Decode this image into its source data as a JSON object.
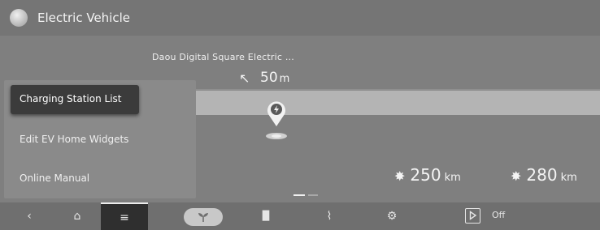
{
  "window": {
    "title": "Electric Vehicle",
    "icon": "moon-icon"
  },
  "map": {
    "destination": "Daou Digital Square Electric ...",
    "direction_icon": "arrow-up-left-icon",
    "distance_value": "50",
    "distance_unit": "m",
    "marker_icon": "charging-station-pin-icon"
  },
  "ranges": [
    {
      "icon": "fan-icon",
      "value": "250",
      "unit": "km"
    },
    {
      "icon": "fan-off-icon",
      "value": "280",
      "unit": "km"
    }
  ],
  "menu": {
    "items": [
      {
        "label": "Charging Station List",
        "selected": true
      },
      {
        "label": "Edit EV Home Widgets",
        "selected": false
      },
      {
        "label": "Online Manual",
        "selected": false
      }
    ]
  },
  "navbar": {
    "back_icon": "back-icon",
    "home_icon": "home-icon",
    "menu_icon": "menu-icon",
    "eco_icon": "leaf-icon",
    "energy_icon": "bar-chart-icon",
    "charge_icon": "charging-plug-icon",
    "settings_icon": "gear-icon",
    "play_icon": "play-icon",
    "play_status": "Off"
  },
  "colors": {
    "selected_bg": "#3b3b3b",
    "menu_bg": "#8a8a8a",
    "background": "#7d7d7d"
  }
}
